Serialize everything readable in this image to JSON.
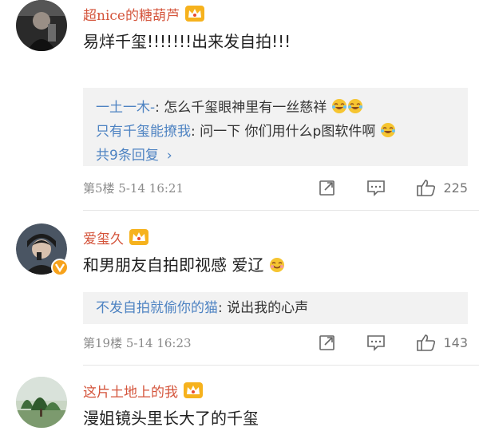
{
  "comments": [
    {
      "username": "超nice的糖葫芦",
      "text": "易烊千玺!!!!!!!出来发自拍!!!",
      "replies": [
        {
          "name": "一土一木-",
          "text": ": 怎么千玺眼神里有一丝慈祥"
        },
        {
          "name": "只有千玺能撩我",
          "text": ": 问一下 你们用什么p图软件啊"
        }
      ],
      "more_replies": "共9条回复",
      "floor_time": "第5楼  5-14 16:21",
      "like_count": "225"
    },
    {
      "username": "爱玺久",
      "text": "和男朋友自拍即视感 爱辽",
      "replies": [
        {
          "name": "不发自拍就偷你的猫",
          "text": ": 说出我的心声"
        }
      ],
      "floor_time": "第19楼  5-14 16:23",
      "like_count": "143"
    },
    {
      "username": "这片土地上的我",
      "text": "漫姐镜头里长大了的千玺"
    }
  ],
  "colors": {
    "username": "#d4543b",
    "reply_name": "#4e83c2",
    "vip_badge": "#f7a21b",
    "reply_bg": "#f2f2f2"
  },
  "icons": {
    "crown": "crown-icon",
    "forward": "forward-icon",
    "comment": "comment-icon",
    "like": "thumbs-up-icon",
    "laugh_cry": "laugh-cry-emoji",
    "grin": "grin-emoji"
  }
}
